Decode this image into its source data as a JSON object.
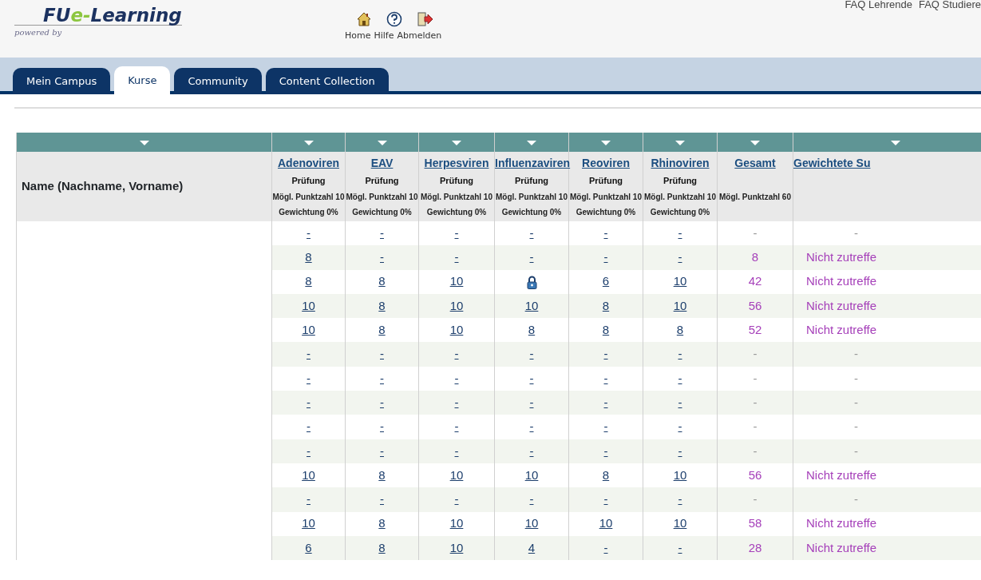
{
  "logo": {
    "parts": [
      {
        "text": "FU",
        "kind": "main"
      },
      {
        "text": "e-",
        "kind": "accent"
      },
      {
        "text": "Learning",
        "kind": "main"
      }
    ],
    "tagline": "powered by"
  },
  "toolbar": [
    {
      "label": "Home",
      "kind": "home"
    },
    {
      "label": "Hilfe",
      "kind": "help"
    },
    {
      "label": "Abmelden",
      "kind": "logout"
    }
  ],
  "top_links": [
    "FAQ Lehrende",
    "FAQ Studiere"
  ],
  "tabs": [
    {
      "label": "Mein Campus",
      "selected": false
    },
    {
      "label": "Kurse",
      "selected": true
    },
    {
      "label": "Community",
      "selected": false
    },
    {
      "label": "Content Collection",
      "selected": false
    }
  ],
  "table": {
    "name_column": "Name (Nachname, Vorname)",
    "columns": [
      {
        "title": "Adenoviren",
        "type": "Prüfung",
        "points": "Mögl. Punktzahl 10",
        "weight": "Gewichtung 0%"
      },
      {
        "title": "EAV",
        "type": "Prüfung",
        "points": "Mögl. Punktzahl 10",
        "weight": "Gewichtung 0%"
      },
      {
        "title": "Herpesviren",
        "type": "Prüfung",
        "points": "Mögl. Punktzahl 10",
        "weight": "Gewichtung 0%"
      },
      {
        "title": "Influenzaviren",
        "type": "Prüfung",
        "points": "Mögl. Punktzahl 10",
        "weight": "Gewichtung 0%"
      },
      {
        "title": "Reoviren",
        "type": "Prüfung",
        "points": "Mögl. Punktzahl 10",
        "weight": "Gewichtung 0%"
      },
      {
        "title": "Rhinoviren",
        "type": "Prüfung",
        "points": "Mögl. Punktzahl 10",
        "weight": "Gewichtung 0%"
      },
      {
        "title": "Gesamt",
        "points": "Mögl. Punktzahl 60"
      },
      {
        "title": "Gewichtete Su"
      }
    ],
    "rows": [
      {
        "grades": [
          "-",
          "-",
          "-",
          "-",
          "-",
          "-"
        ],
        "total": "-",
        "weighted": "-"
      },
      {
        "grades": [
          "8",
          "-",
          "-",
          "-",
          "-",
          "-"
        ],
        "total": "8",
        "weighted": "Nicht zutreffe"
      },
      {
        "grades": [
          "8",
          "8",
          "10",
          {
            "kind": "locked"
          },
          "6",
          "10"
        ],
        "total": "42",
        "weighted": "Nicht zutreffe"
      },
      {
        "grades": [
          "10",
          "8",
          "10",
          "10",
          "8",
          "10"
        ],
        "total": "56",
        "weighted": "Nicht zutreffe"
      },
      {
        "grades": [
          "10",
          "8",
          "10",
          "8",
          "8",
          "8"
        ],
        "total": "52",
        "weighted": "Nicht zutreffe"
      },
      {
        "grades": [
          "-",
          "-",
          "-",
          "-",
          "-",
          "-"
        ],
        "total": "-",
        "weighted": "-"
      },
      {
        "grades": [
          "-",
          "-",
          "-",
          "-",
          "-",
          "-"
        ],
        "total": "-",
        "weighted": "-"
      },
      {
        "grades": [
          "-",
          "-",
          "-",
          "-",
          "-",
          "-"
        ],
        "total": "-",
        "weighted": "-"
      },
      {
        "grades": [
          "-",
          "-",
          "-",
          "-",
          "-",
          "-"
        ],
        "total": "-",
        "weighted": "-"
      },
      {
        "grades": [
          "-",
          "-",
          "-",
          "-",
          "-",
          "-"
        ],
        "total": "-",
        "weighted": "-"
      },
      {
        "grades": [
          "10",
          "8",
          "10",
          "10",
          "8",
          "10"
        ],
        "total": "56",
        "weighted": "Nicht zutreffe"
      },
      {
        "grades": [
          "-",
          "-",
          "-",
          "-",
          "-",
          "-"
        ],
        "total": "-",
        "weighted": "-"
      },
      {
        "grades": [
          "10",
          "8",
          "10",
          "10",
          "10",
          "10"
        ],
        "total": "58",
        "weighted": "Nicht zutreffe"
      },
      {
        "grades": [
          "6",
          "8",
          "10",
          "4",
          "-",
          "-"
        ],
        "total": "28",
        "weighted": "Nicht zutreffe"
      }
    ]
  }
}
